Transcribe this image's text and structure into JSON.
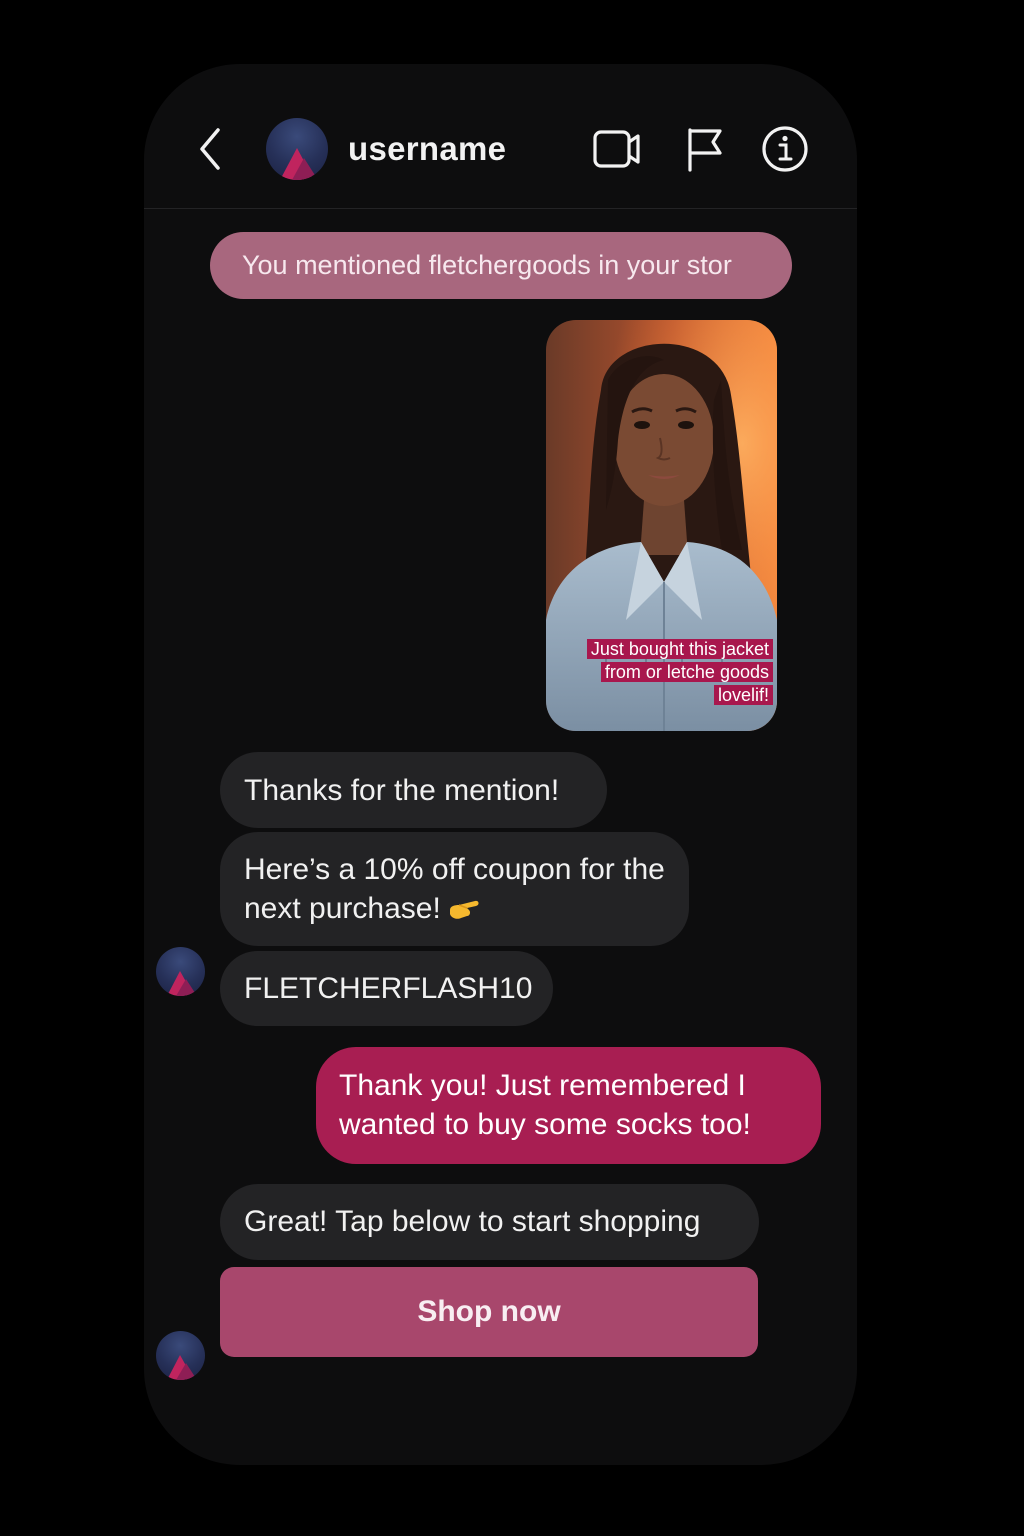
{
  "header": {
    "username": "username"
  },
  "mention": {
    "text": "You mentioned fletchergoods in your stor"
  },
  "story": {
    "caption_lines": [
      "Just bought this jacket",
      "from or letche goods",
      "lovelif!"
    ]
  },
  "messages": {
    "thanks": "Thanks for the mention!",
    "coupon": "Here’s a 10% off coupon for the next purchase!",
    "code": "FLETCHERFLASH10",
    "reply": "Thank you! Just remembered I wanted to buy some socks too!",
    "great": "Great! Tap below to start shopping"
  },
  "cta": {
    "label": "Shop now"
  },
  "colors": {
    "background": "#000000",
    "panel": "#0d0d0e",
    "incoming_bubble": "#232325",
    "outgoing_bubble": "#a81e52",
    "mention_pill": "#a8677e",
    "cta_button": "#a8476c",
    "caption_highlight": "#a8174d"
  },
  "icons": [
    "back-chevron-icon",
    "video-camera-icon",
    "flag-icon",
    "info-icon",
    "pointing-hand-emoji"
  ]
}
